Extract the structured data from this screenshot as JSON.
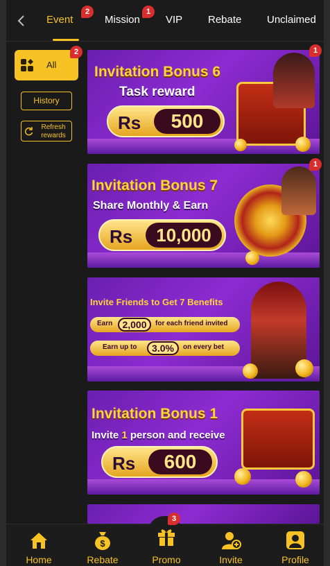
{
  "tabs": {
    "items": [
      {
        "label": "Event",
        "badge": "2",
        "active": true
      },
      {
        "label": "Mission",
        "badge": "1"
      },
      {
        "label": "VIP"
      },
      {
        "label": "Rebate"
      },
      {
        "label": "Unclaimed"
      }
    ]
  },
  "sidebar": {
    "all_label": "All",
    "all_badge": "2",
    "history_label": "History",
    "refresh_label": "Refresh rewards"
  },
  "banners": [
    {
      "title": "Invitation Bonus 6",
      "subtitle": "Task reward",
      "currency": "Rs",
      "amount": "500",
      "badge": "1"
    },
    {
      "title": "Invitation Bonus 7",
      "subtitle": "Share Monthly & Earn",
      "currency": "Rs",
      "amount": "10,000",
      "badge": "1"
    },
    {
      "title": "Invite Friends to Get 7 Benefits",
      "row1": {
        "pre": "Earn",
        "value": "2,000",
        "post": "for each friend invited"
      },
      "row2": {
        "pre": "Earn up to",
        "value": "3.0%",
        "post": "on every bet"
      }
    },
    {
      "title": "Invitation Bonus 1",
      "subtitle_pre": "Invite",
      "subtitle_num": "1",
      "subtitle_post": "person and receive",
      "currency": "Rs",
      "amount": "600"
    }
  ],
  "bottom_nav": {
    "items": [
      {
        "label": "Home",
        "icon": "home-icon"
      },
      {
        "label": "Rebate",
        "icon": "money-bag-icon"
      },
      {
        "label": "Promo",
        "icon": "gift-icon",
        "badge": "3"
      },
      {
        "label": "Invite",
        "icon": "add-user-icon"
      },
      {
        "label": "Profile",
        "icon": "profile-icon"
      }
    ]
  },
  "colors": {
    "accent": "#f7c324",
    "badge": "#d92e2e",
    "background": "#1a1a1a"
  }
}
